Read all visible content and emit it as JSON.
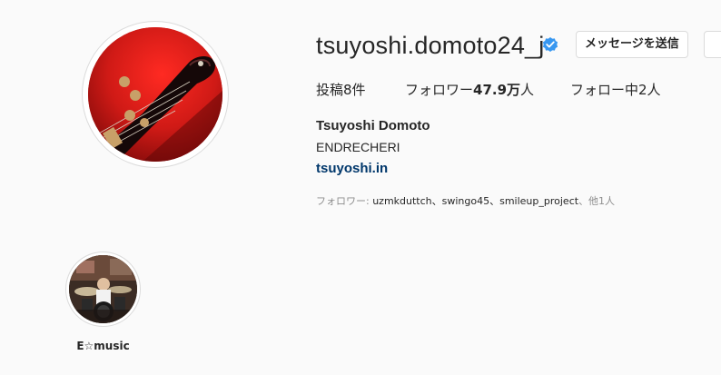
{
  "profile": {
    "username": "tsuyoshi.domoto24_j",
    "verified_icon": "verified-badge-icon",
    "message_button": "メッセージを送信",
    "stats": {
      "posts_label": "投稿",
      "posts_count": "8件",
      "followers_label": "フォロワー",
      "followers_count": "47.9万",
      "followers_suffix": "人",
      "following_label": "フォロー中",
      "following_count": "2人"
    },
    "full_name": "Tsuyoshi Domoto",
    "bio": "ENDRECHERI",
    "link": "tsuyoshi.in",
    "followed_by": {
      "prefix": "フォロワー: ",
      "names": "uzmkduttch、swingo45、smileup_project",
      "suffix": "、他1人"
    }
  },
  "highlights": [
    {
      "label": "E☆music"
    }
  ],
  "colors": {
    "background": "#fafafa",
    "text": "#262626",
    "muted": "#8e8e8e",
    "link": "#00376b",
    "verified": "#3897f0",
    "border": "#dbdbdb"
  }
}
